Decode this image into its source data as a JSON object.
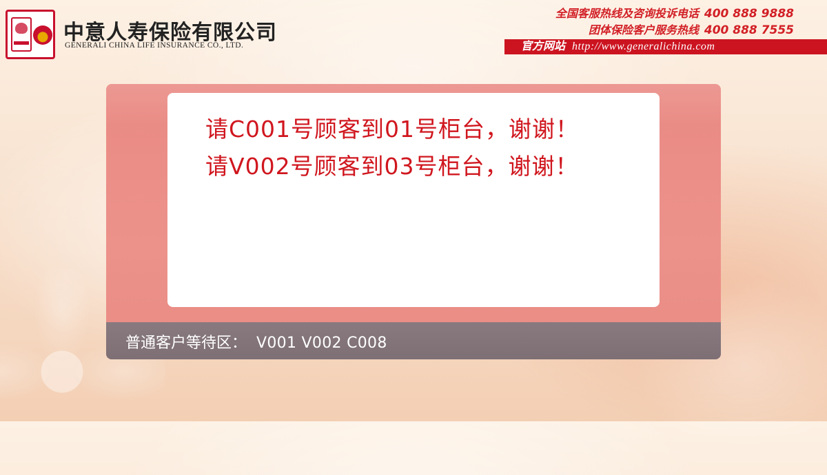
{
  "header": {
    "company_cn": "中意人寿保险有限公司",
    "company_en": "GENERALI CHINA LIFE INSURANCE CO., LTD.",
    "hotlines": [
      {
        "label": "全国客服热线及咨询投诉电话",
        "number": "400  888  9888"
      },
      {
        "label": "团体保险客户服务热线",
        "number": "400  888  7555"
      }
    ],
    "website": {
      "label": "官方网站",
      "url": "http://www.generalichina.com"
    }
  },
  "board": {
    "calls": [
      "请C001号顾客到01号柜台，谢谢！",
      "请V002号顾客到03号柜台，谢谢！"
    ],
    "waiting": {
      "label": "普通客户等待区：",
      "queue": "V001 V002 C008"
    }
  },
  "colors": {
    "brand_red": "#d0161e",
    "board_pink": "#ea8a84",
    "waiting_gray": "#7d6f74"
  }
}
